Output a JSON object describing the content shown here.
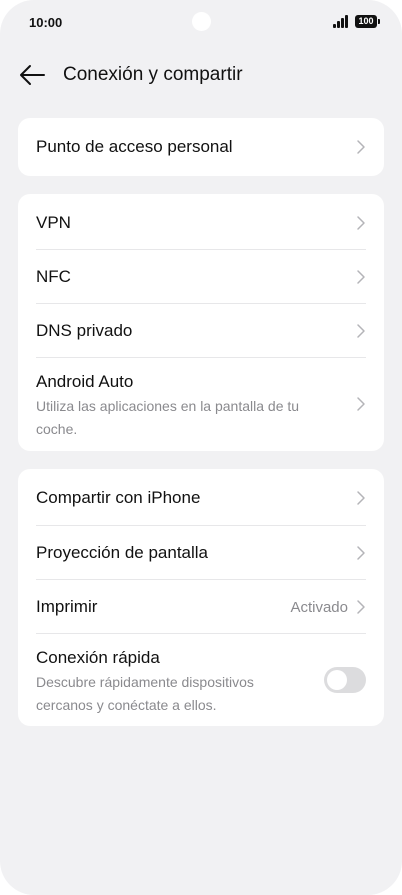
{
  "status_bar": {
    "time": "10:00",
    "battery": "100"
  },
  "header": {
    "title": "Conexión y compartir"
  },
  "groups": [
    {
      "items": [
        {
          "title": "Punto de acceso personal"
        }
      ]
    },
    {
      "items": [
        {
          "title": "VPN"
        },
        {
          "title": "NFC"
        },
        {
          "title": "DNS privado"
        },
        {
          "title": "Android Auto",
          "subtitle": "Utiliza las aplicaciones en la pantalla de tu coche."
        }
      ]
    },
    {
      "items": [
        {
          "title": "Compartir con iPhone"
        },
        {
          "title": "Proyección de pantalla"
        },
        {
          "title": "Imprimir",
          "value": "Activado"
        },
        {
          "title": "Conexión rápida",
          "subtitle": "Descubre rápidamente dispositivos cercanos y conéctate a ellos.",
          "toggle": false
        }
      ]
    }
  ],
  "colors": {
    "background": "#f1f1f3",
    "card": "#ffffff",
    "text_primary": "#111111",
    "text_secondary": "#8a8a8e",
    "chevron": "#b4b4b8",
    "toggle_off": "#dcdcde"
  },
  "icons": {
    "back": "arrow-left-icon",
    "chevron": "chevron-right-icon",
    "signal": "signal-bars-icon",
    "battery": "battery-icon"
  }
}
